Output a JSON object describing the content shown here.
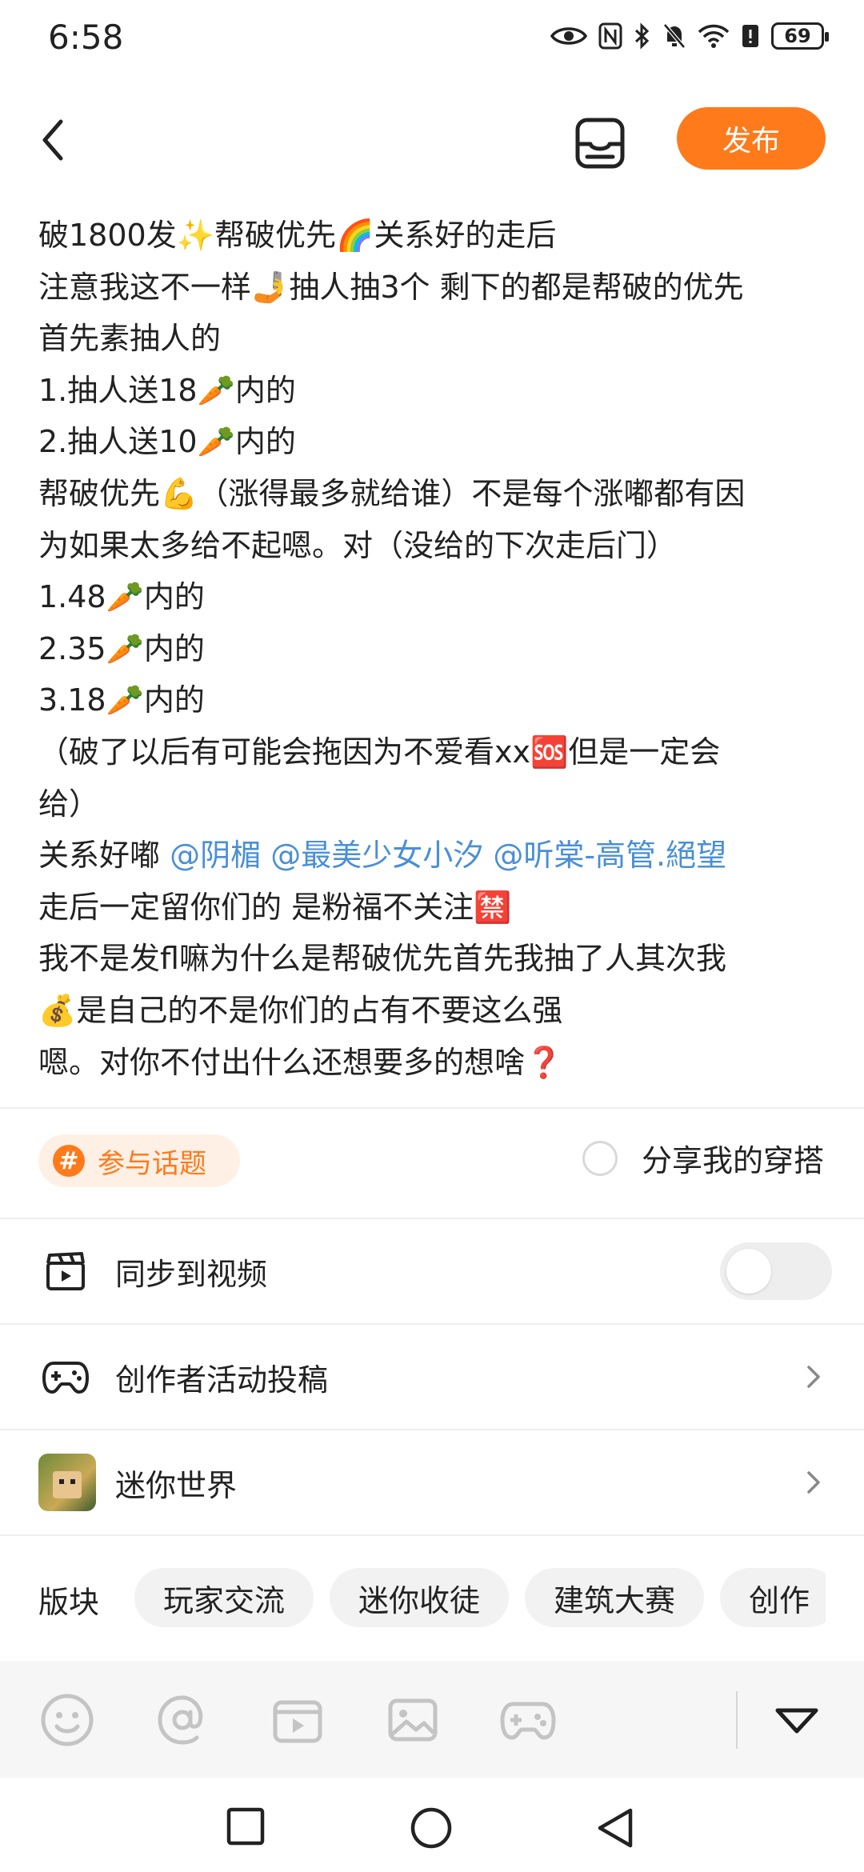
{
  "status_bar": {
    "time": "6:58",
    "battery": "69",
    "icons": [
      "eye-icon",
      "nfc-icon",
      "bluetooth-icon",
      "mute-bell-icon",
      "wifi-icon",
      "alert-icon",
      "battery-icon"
    ]
  },
  "header": {
    "publish_label": "发布"
  },
  "post": {
    "lines": [
      "破1800发✨帮破优先🌈关系好的走后",
      "注意我这不一样🤳抽人抽3个 剩下的都是帮破的优先",
      "首先素抽人的",
      "1.抽人送18🥕内的",
      "2.抽人送10🥕内的",
      "帮破优先💪（涨得最多就给谁）不是每个涨嘟都有因",
      "为如果太多给不起嗯。对（没给的下次走后门）",
      "1.48🥕内的",
      "2.35🥕内的",
      "3.18🥕内的",
      "（破了以后有可能会拖因为不爱看xx🆘但是一定会",
      "给）"
    ],
    "mention_prefix": "关系好嘟 ",
    "mentions": [
      "@阴楣",
      "@最美少女小汐",
      "@听棠-高管.絕望"
    ],
    "lines_after": [
      "走后一定留你们的 是粉福不关注🈲",
      "我不是发fl嘛为什么是帮破优先首先我抽了人其次我",
      "💰是自己的不是你们的占有不要这么强",
      "嗯。对你不付出什么还想要多的想啥❓"
    ]
  },
  "topic": {
    "chip_label": "参与话题",
    "share_label": "分享我的穿搭"
  },
  "rows": {
    "sync_video": "同步到视频",
    "creator_activity": "创作者活动投稿",
    "game": "迷你世界"
  },
  "sections": {
    "title": "版块",
    "chips": [
      "玩家交流",
      "迷你收徒",
      "建筑大赛",
      "创作"
    ]
  },
  "colors": {
    "accent": "#ff7a1a",
    "mention": "#4a8fd6"
  }
}
